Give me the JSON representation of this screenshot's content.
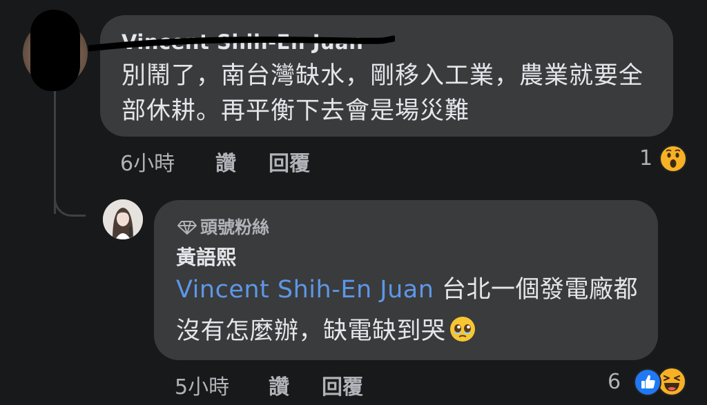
{
  "comment1": {
    "author": "Vincent Shih-En Juan",
    "text": "別鬧了，南台灣缺水，剛移入工業，農業就要全部休耕。再平衡下去會是場災難",
    "time": "6小時",
    "like_label": "讚",
    "reply_label": "回覆",
    "reaction_count": "1",
    "reaction_icons": [
      "wow-icon"
    ]
  },
  "reply1": {
    "badge": "頭號粉絲",
    "author": "黃語熙",
    "mention": "Vincent Shih-En Juan",
    "text": " 台北一個發電廠都沒有怎麼辦，缺電缺到哭",
    "time": "5小時",
    "like_label": "讚",
    "reply_label": "回覆",
    "reaction_count": "6",
    "reaction_icons": [
      "like-icon",
      "haha-icon"
    ]
  },
  "colors": {
    "background": "#18191a",
    "bubble": "#3a3b3c",
    "text": "#e4e6eb",
    "meta": "#b0b3b8",
    "mention": "#5d97e8",
    "like_blue": "#2078f4",
    "emoji_yellow": "#f7b125"
  }
}
